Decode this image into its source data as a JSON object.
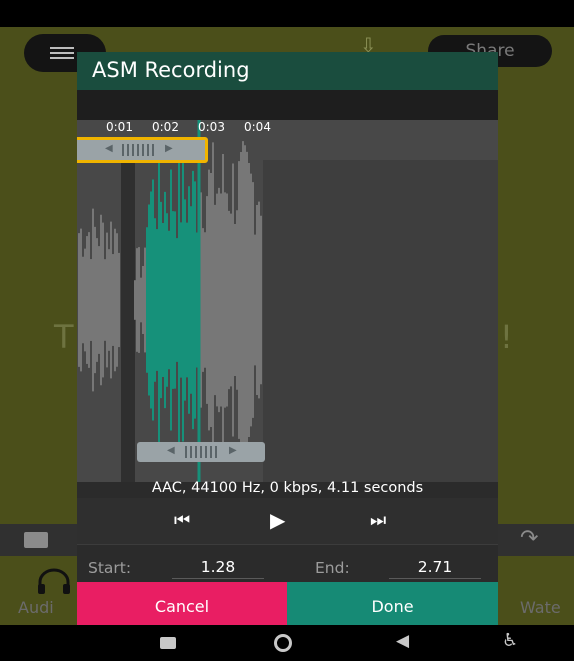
{
  "background_app": {
    "share_label": "Share",
    "left_text": "T",
    "right_text": "!",
    "label_left": "Audi",
    "label_right": "Wate"
  },
  "icons": {
    "menu": "hamburger-menu-icon",
    "download": "download-icon",
    "image": "image-icon",
    "redo": "redo-icon",
    "headphones": "headphones-icon",
    "skip_back": "skip-previous-icon",
    "play": "play-icon",
    "skip_forward": "skip-next-icon",
    "nav_recents": "recents-square-icon",
    "nav_home": "home-circle-icon",
    "nav_back": "back-triangle-icon",
    "nav_accessibility": "accessibility-icon"
  },
  "dialog": {
    "title": "ASM Recording",
    "timeline_labels": [
      "0:01",
      "0:02",
      "0:03",
      "0:04"
    ],
    "info": "AAC, 44100 Hz, 0 kbps, 4.11 seconds",
    "start_label": "Start:",
    "start_value": "1.28",
    "end_label": "End:",
    "end_value": "2.71",
    "cancel_label": "Cancel",
    "done_label": "Done"
  },
  "colors": {
    "header": "#1a4d3e",
    "waveform_selected": "#16917a",
    "waveform_unselected": "#777777",
    "cancel": "#e91e63",
    "done": "#168a75",
    "handle_highlight": "#f0b400"
  }
}
